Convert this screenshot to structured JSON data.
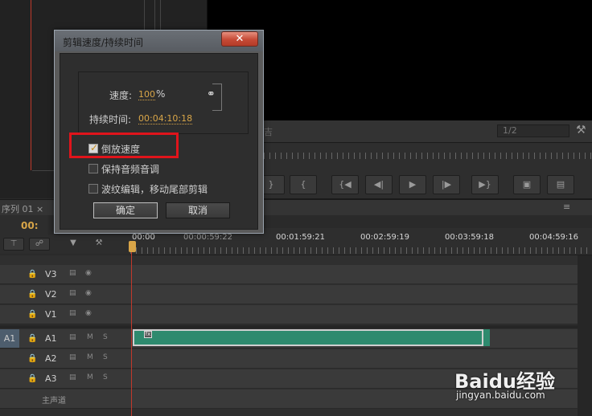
{
  "dialog": {
    "title": "剪辑速度/持续时间",
    "close": "✕",
    "speed_label": "速度:",
    "speed_value": "100",
    "speed_unit": "%",
    "duration_label": "持续时间:",
    "duration_value": "00:04:10:18",
    "reverse_label": "倒放速度",
    "reverse_checked": true,
    "pitch_label": "保持音频音调",
    "pitch_checked": false,
    "ripple_label": "波纹编辑，移动尾部剪辑",
    "ripple_checked": false,
    "ok_label": "确定",
    "cancel_label": "取消"
  },
  "program": {
    "resolution": "1/2",
    "partial_text": "吉"
  },
  "timeline": {
    "tab_label": "序列 01 ×",
    "timecode": "00:",
    "ruler_labels": [
      "00:00",
      "00:00:59:22",
      "00:01:59:21",
      "00:02:59:19",
      "00:03:59:18",
      "00:04:59:16"
    ],
    "tracks": [
      {
        "name": "V3",
        "src": ""
      },
      {
        "name": "V2",
        "src": ""
      },
      {
        "name": "V1",
        "src": ""
      },
      {
        "name": "A1",
        "src": "A1"
      },
      {
        "name": "A2",
        "src": ""
      },
      {
        "name": "A3",
        "src": ""
      }
    ],
    "master_label": "主声道",
    "clip_badge": "fx"
  },
  "watermark": {
    "brand": "Baidu经验",
    "url": "jingyan.baidu.com"
  },
  "colors": {
    "accent": "#d8a548",
    "clip": "#2e8a6e",
    "highlight": "#e0141b"
  }
}
